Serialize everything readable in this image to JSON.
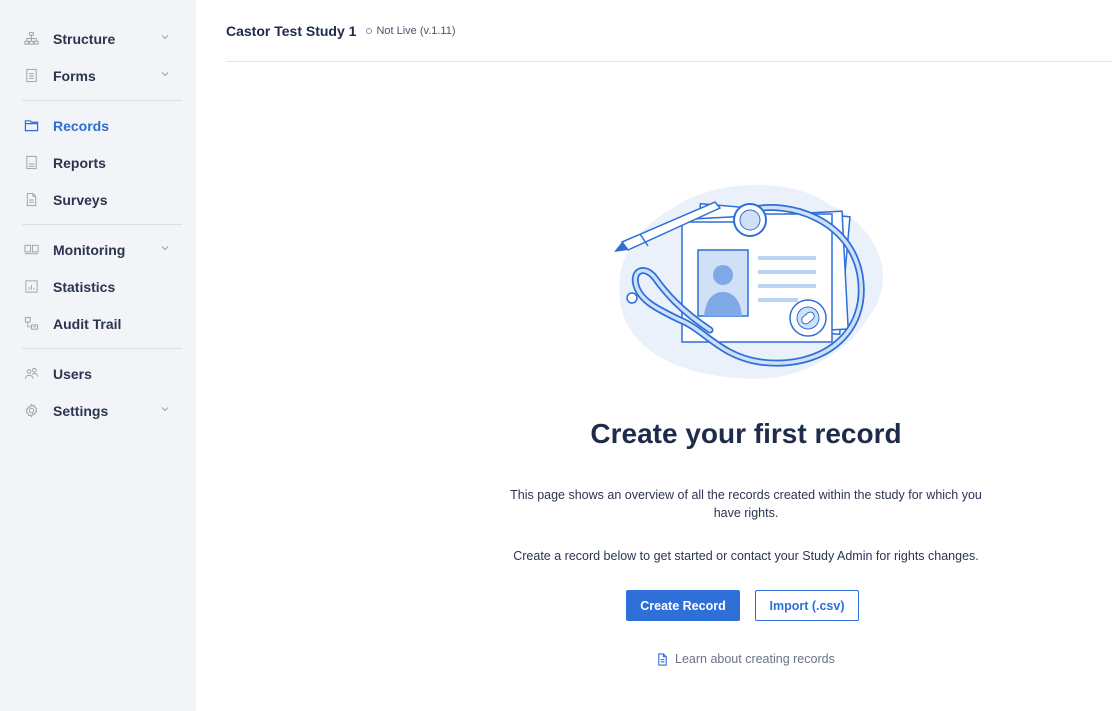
{
  "sidebar": {
    "items": [
      {
        "label": "Structure",
        "icon": "structure-icon",
        "has_chevron": true
      },
      {
        "label": "Forms",
        "icon": "forms-icon",
        "has_chevron": true
      },
      {
        "label": "Records",
        "icon": "folder-icon",
        "active": true
      },
      {
        "label": "Reports",
        "icon": "reports-icon"
      },
      {
        "label": "Surveys",
        "icon": "surveys-icon"
      },
      {
        "label": "Monitoring",
        "icon": "monitoring-icon",
        "has_chevron": true
      },
      {
        "label": "Statistics",
        "icon": "statistics-icon"
      },
      {
        "label": "Audit Trail",
        "icon": "audit-trail-icon"
      },
      {
        "label": "Users",
        "icon": "users-icon"
      },
      {
        "label": "Settings",
        "icon": "gear-icon",
        "has_chevron": true
      }
    ]
  },
  "header": {
    "study_title": "Castor Test Study 1",
    "status": "Not Live (v.1.11)"
  },
  "empty_state": {
    "headline": "Create your first record",
    "description": "This page shows an overview of all the records created within the study for which you have rights.",
    "description2": "Create a record below to get started or contact your Study Admin for rights changes.",
    "primary_button": "Create Record",
    "secondary_button": "Import (.csv)",
    "learn_link": "Learn about creating records"
  },
  "colors": {
    "accent": "#2e6fd8",
    "sidebar_bg": "#f3f4f7",
    "text": "#1d2a4d"
  }
}
